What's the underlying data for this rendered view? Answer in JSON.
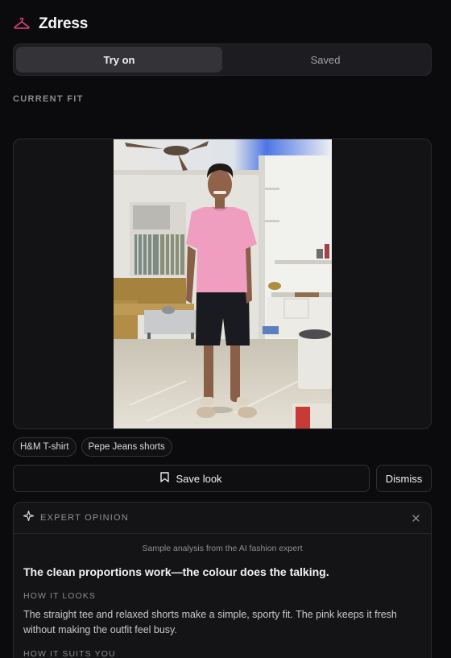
{
  "app": {
    "title": "Zdress",
    "logo_icon": "hanger-icon",
    "accent": "#e0457b"
  },
  "tabs": [
    {
      "label": "Try on",
      "active": true
    },
    {
      "label": "Saved",
      "active": false
    }
  ],
  "current_fit": {
    "label": "CURRENT FIT",
    "items": [
      "H&M T-shirt",
      "Pepe Jeans shorts"
    ]
  },
  "actions": {
    "save_label": "Save look",
    "save_icon": "bookmark-icon",
    "dismiss_label": "Dismiss"
  },
  "expert": {
    "label": "EXPERT OPINION",
    "icon": "sparkle-icon",
    "close_icon": "close-icon",
    "note": "Sample analysis from the AI fashion expert",
    "headline": "The clean proportions work—the colour does the talking.",
    "sections": [
      {
        "title": "HOW IT LOOKS",
        "text": "The straight tee and relaxed shorts make a simple, sporty fit. The pink keeps it fresh without making the outfit feel busy."
      },
      {
        "title": "HOW IT SUITS YOU",
        "text": ""
      }
    ]
  }
}
